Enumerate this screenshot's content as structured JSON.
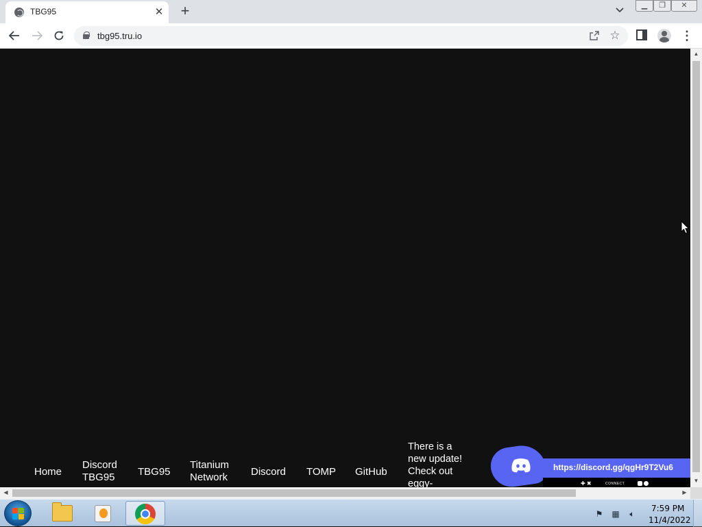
{
  "browser": {
    "tab_title": "TBG95",
    "tab_close": "✕",
    "new_tab": "+",
    "url": "tbg95.tru.io",
    "window_controls": {
      "minimize": "▁",
      "restore": "❐",
      "close": "✕"
    }
  },
  "page": {
    "nav_links": [
      {
        "label_line1": "Home",
        "label_line2": ""
      },
      {
        "label_line1": "Discord",
        "label_line2": "TBG95"
      },
      {
        "label_line1": "TBG95",
        "label_line2": ""
      },
      {
        "label_line1": "Titanium",
        "label_line2": "Network"
      },
      {
        "label_line1": "Discord",
        "label_line2": ""
      },
      {
        "label_line1": "TOMP",
        "label_line2": ""
      },
      {
        "label_line1": "GitHub",
        "label_line2": ""
      }
    ],
    "update_notice": [
      "There is a",
      "new update!",
      "Check out",
      "eggy-"
    ],
    "discord_widget": {
      "invite_url": "https://discord.gg/qgHr9T2Vu6",
      "controls": "✚ ✖",
      "connect_label": "CONNECT"
    }
  },
  "taskbar": {
    "clock_time": "7:59 PM",
    "clock_date": "11/4/2022"
  },
  "colors": {
    "page_background": "#111111",
    "discord_blurple": "#5865f2"
  }
}
